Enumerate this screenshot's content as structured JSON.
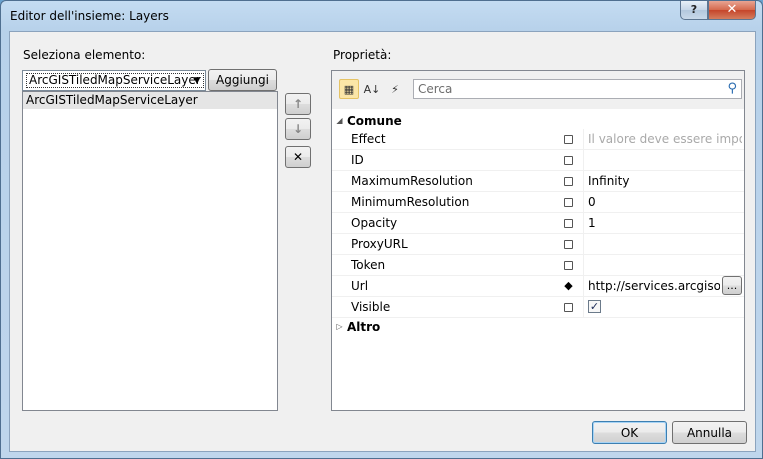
{
  "window": {
    "title": "Editor dell'insieme: Layers",
    "help_label": "?",
    "close_label": "✕"
  },
  "left": {
    "label": "Seleziona elemento:",
    "combo_value": "ArcGISTiledMapServiceLayer",
    "add_label": "Aggiungi",
    "items": [
      {
        "label": "ArcGISTiledMapServiceLayer"
      }
    ],
    "icons": {
      "up": "↑",
      "down": "↓",
      "remove": "✕"
    }
  },
  "right": {
    "label": "Proprietà:",
    "search_placeholder": "Cerca",
    "categories": {
      "common": "Comune",
      "other": "Altro"
    },
    "properties": [
      {
        "name": "Effect",
        "value": "Il valore deve essere impostato"
      },
      {
        "name": "ID",
        "value": ""
      },
      {
        "name": "MaximumResolution",
        "value": "Infinity"
      },
      {
        "name": "MinimumResolution",
        "value": "0"
      },
      {
        "name": "Opacity",
        "value": "1"
      },
      {
        "name": "ProxyURL",
        "value": ""
      },
      {
        "name": "Token",
        "value": ""
      },
      {
        "name": "Url",
        "value": "http://services.arcgisonline.com",
        "button": "..."
      },
      {
        "name": "Visible",
        "checked": true
      }
    ]
  },
  "buttons": {
    "ok": "OK",
    "cancel": "Annulla"
  }
}
